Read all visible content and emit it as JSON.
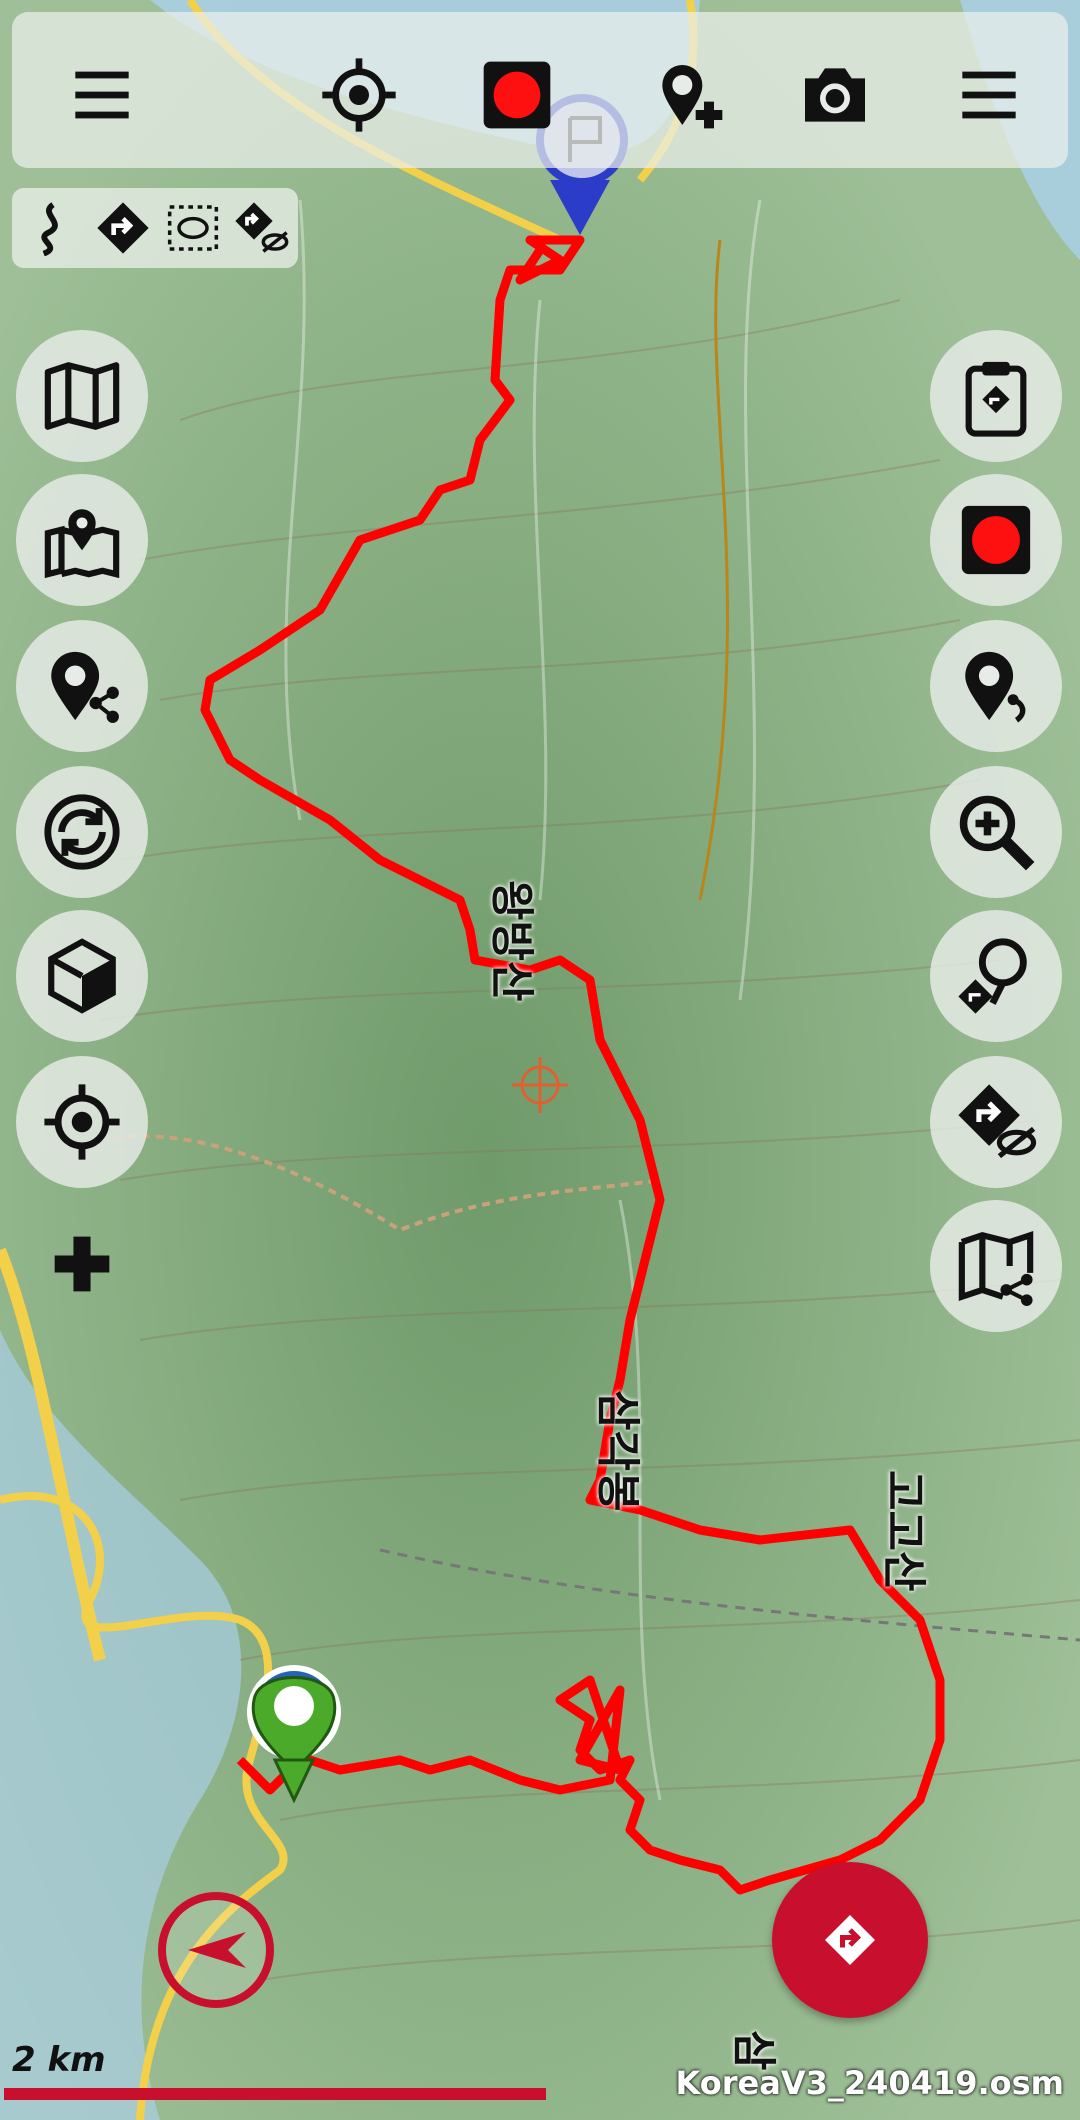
{
  "app": {
    "map_file": "KoreaV3_240419.osm"
  },
  "scale": {
    "label": "2 km"
  },
  "colors": {
    "track": "#ff0000",
    "accent": "#c8102e",
    "panel": "#e8ece8"
  },
  "map_labels": [
    {
      "text": "왕방산"
    },
    {
      "text": "삼각봉"
    },
    {
      "text": "고고산"
    },
    {
      "text": "삼"
    }
  ],
  "toolbar": {
    "left_menu_icon": "hamburger-menu-icon",
    "locate_icon": "crosshair-icon",
    "record_icon": "record-icon",
    "add_poi_icon": "add-pin-icon",
    "camera_icon": "camera-icon",
    "right_menu_icon": "hamburger-menu-icon"
  },
  "left_buttons": [
    "map-layers-icon",
    "map-pin-icon",
    "share-pin-icon",
    "rotate-icon",
    "cube-3d-icon",
    "crosshair-icon",
    "plus-icon"
  ],
  "right_buttons": [
    "clipboard-route-icon",
    "record-icon",
    "pin-voice-icon",
    "zoom-in-icon",
    "route-pin-icon",
    "hide-route-icon",
    "share-map-icon"
  ]
}
